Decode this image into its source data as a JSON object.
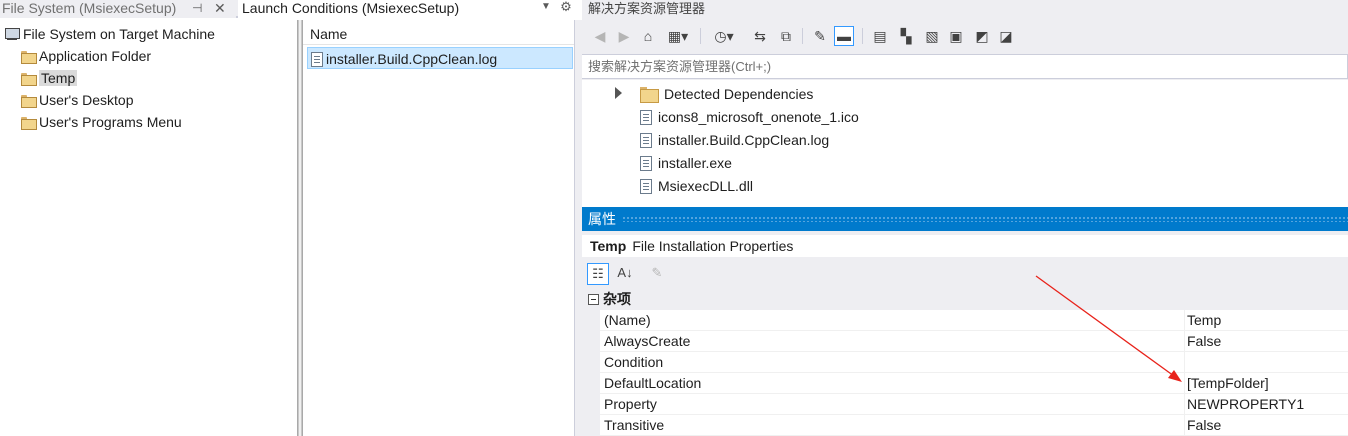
{
  "tabs": {
    "inactive_label": "File System (MsiexecSetup)",
    "active_label": "Launch Conditions (MsiexecSetup)",
    "pin_icon": "pin-icon",
    "close_icon": "close-icon",
    "dropdown_icon": "chevron-down-icon",
    "gear_icon": "gear-icon"
  },
  "tree": {
    "root": "File System on Target Machine",
    "items": [
      {
        "label": "Application Folder"
      },
      {
        "label": "Temp",
        "selected": true
      },
      {
        "label": "User's Desktop"
      },
      {
        "label": "User's Programs Menu"
      }
    ]
  },
  "list": {
    "header": "Name",
    "rows": [
      {
        "label": "installer.Build.CppClean.log"
      }
    ]
  },
  "solution_explorer": {
    "title": "解决方案资源管理器",
    "search_placeholder": "搜索解决方案资源管理器(Ctrl+;)",
    "items": [
      {
        "label": "Detected Dependencies",
        "type": "folder"
      },
      {
        "label": "icons8_microsoft_onenote_1.ico",
        "type": "file"
      },
      {
        "label": "installer.Build.CppClean.log",
        "type": "file"
      },
      {
        "label": "installer.exe",
        "type": "file"
      },
      {
        "label": "MsiexecDLL.dll",
        "type": "file"
      }
    ]
  },
  "properties": {
    "title": "属性",
    "object_name": "Temp",
    "object_type": "File Installation Properties",
    "category": "杂项",
    "rows": [
      {
        "name": "(Name)",
        "value": "Temp"
      },
      {
        "name": "AlwaysCreate",
        "value": "False"
      },
      {
        "name": "Condition",
        "value": ""
      },
      {
        "name": "DefaultLocation",
        "value": "[TempFolder]"
      },
      {
        "name": "Property",
        "value": "NEWPROPERTY1"
      },
      {
        "name": "Transitive",
        "value": "False"
      }
    ]
  },
  "colors": {
    "accent": "#007acc",
    "selection": "#cce8ff",
    "annotation_arrow": "#e8221a"
  }
}
